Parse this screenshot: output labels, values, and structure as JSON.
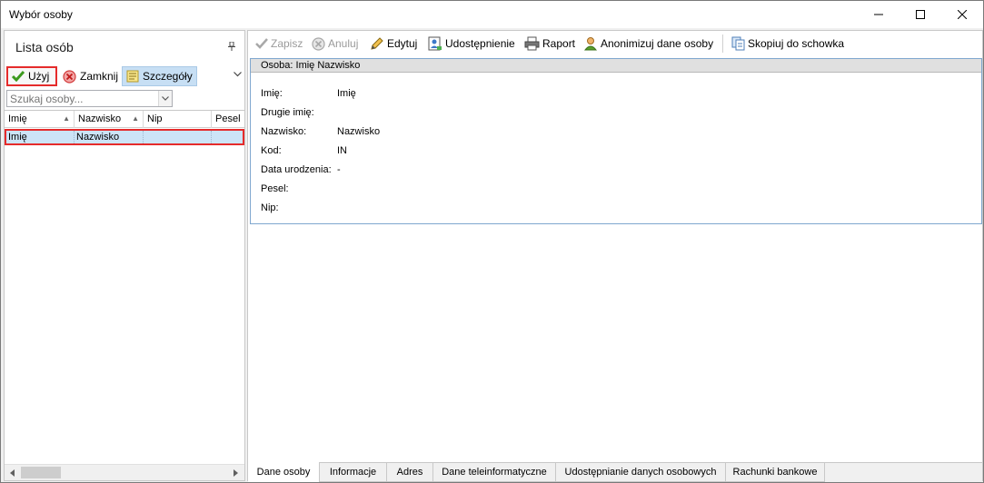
{
  "window": {
    "title": "Wybór osoby",
    "min_icon": "minimize-icon",
    "max_icon": "maximize-icon",
    "close_icon": "close-icon"
  },
  "left_panel": {
    "title": "Lista osób",
    "toolbar": {
      "use_label": "Użyj",
      "close_label": "Zamknij",
      "details_label": "Szczegóły"
    },
    "search": {
      "placeholder": "Szukaj osoby..."
    },
    "grid": {
      "columns": [
        "Imię",
        "Nazwisko",
        "Nip",
        "Pesel"
      ],
      "rows": [
        [
          "Imię",
          "Nazwisko",
          "",
          ""
        ]
      ]
    }
  },
  "right_panel": {
    "toolbar": {
      "save_label": "Zapisz",
      "cancel_label": "Anuluj",
      "edit_label": "Edytuj",
      "share_label": "Udostępnienie",
      "report_label": "Raport",
      "anonymize_label": "Anonimizuj dane osoby",
      "copy_label": "Skopiuj do schowka"
    },
    "group_caption": "Osoba: Imię  Nazwisko",
    "fields": [
      {
        "label": "Imię:",
        "value": "Imię"
      },
      {
        "label": "Drugie imię:",
        "value": ""
      },
      {
        "label": "Nazwisko:",
        "value": "Nazwisko"
      },
      {
        "label": "Kod:",
        "value": "IN"
      },
      {
        "label": "Data urodzenia:",
        "value": "-"
      },
      {
        "label": "Pesel:",
        "value": ""
      },
      {
        "label": "Nip:",
        "value": ""
      }
    ],
    "tabs": [
      "Dane osoby",
      "Informacje",
      "Adres",
      "Dane teleinformatyczne",
      "Udostępnianie danych osobowych",
      "Rachunki bankowe"
    ]
  },
  "colors": {
    "highlight_red": "#e52b2b",
    "selection_blue": "#cce4f7",
    "check_green": "#3c9a1e"
  }
}
